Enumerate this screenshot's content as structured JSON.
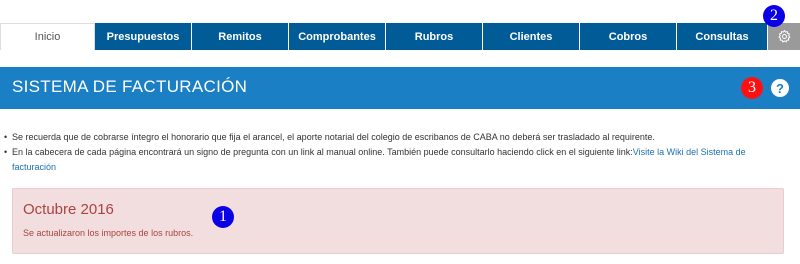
{
  "tabs": [
    {
      "label": "Inicio",
      "active": true
    },
    {
      "label": "Presupuestos"
    },
    {
      "label": "Remitos"
    },
    {
      "label": "Comprobantes"
    },
    {
      "label": "Rubros"
    },
    {
      "label": "Clientes"
    },
    {
      "label": "Cobros"
    },
    {
      "label": "Consultas"
    }
  ],
  "settings_icon": "gear-icon",
  "header": {
    "title": "SISTEMA DE FACTURACIÓN",
    "help_label": "?"
  },
  "badges": {
    "b1": "1",
    "b2": "2",
    "b3": "3"
  },
  "notes": {
    "item1": "Se recuerda que de cobrarse íntegro el honorario que fija el arancel, el aporte notarial del colegio de escribanos de CABA no deberá ser trasladado al requirente.",
    "item2_text": "En la cabecera de cada página encontrará un signo de pregunta con un link al manual online. También puede consultarlo haciendo click en el siguiente link:",
    "item2_link": "Visite la Wiki del Sistema de facturación"
  },
  "alert": {
    "title": "Octubre 2016",
    "text": "Se actualizaron los importes de los rubros."
  },
  "colors": {
    "tab_bg": "#005b96",
    "header_bg": "#1a7fc4",
    "alert_bg": "#f2dede",
    "alert_text": "#a94442"
  }
}
